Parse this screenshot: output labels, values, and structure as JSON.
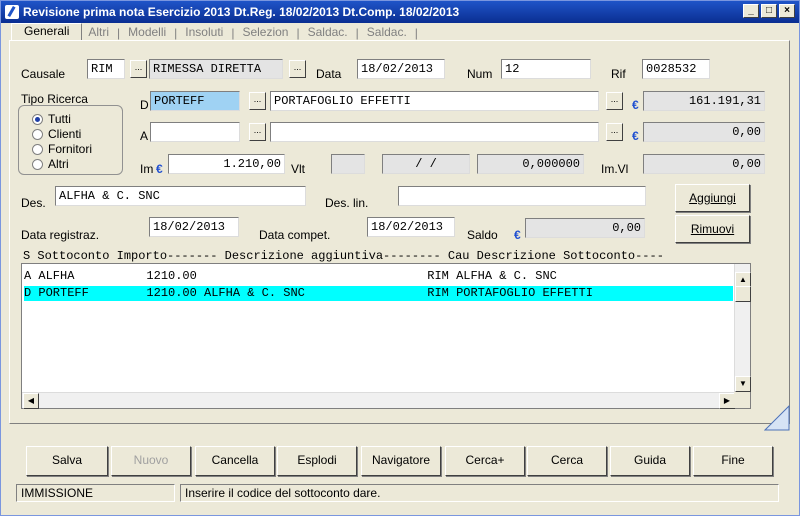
{
  "window": {
    "title": "Revisione prima nota  Esercizio 2013  Dt.Reg. 18/02/2013  Dt.Comp. 18/02/2013"
  },
  "tabs": [
    "Generali",
    "Altri",
    "Modelli",
    "Insoluti",
    "Selezion",
    "Saldac.",
    "Saldac."
  ],
  "form": {
    "causale_label": "Causale",
    "causale_code": "RIM",
    "causale_desc": "RIMESSA DIRETTA",
    "data_label": "Data",
    "data_value": "18/02/2013",
    "num_label": "Num",
    "num_value": "12",
    "rif_label": "Rif",
    "rif_value": "0028532",
    "tipo_ricerca_label": "Tipo Ricerca",
    "radio_options": [
      "Tutti",
      "Clienti",
      "Fornitori",
      "Altri"
    ],
    "radio_selected": "Tutti",
    "d_label": "D",
    "d_code": "PORTEFF",
    "d_desc": "PORTAFOGLIO EFFETTI",
    "d_amount": "161.191,31",
    "a_label": "A",
    "a_code": "",
    "a_desc": "",
    "a_amount": "0,00",
    "im_label": "Im",
    "im_value": "1.210,00",
    "vlt_label": "Vlt",
    "vlt_value": "",
    "vlt_date": "/  /",
    "vlt_rate": "0,000000",
    "imvl_label": "Im.Vl",
    "imvl_value": "0,00",
    "des_label": "Des.",
    "des_value": "ALFHA & C. SNC",
    "deslin_label": "Des. lin.",
    "deslin_value": "",
    "datareg_label": "Data registraz.",
    "datareg_value": "18/02/2013",
    "datacomp_label": "Data compet.",
    "datacomp_value": "18/02/2013",
    "saldo_label": "Saldo",
    "saldo_value": "0,00",
    "euro_symbol": "€"
  },
  "side_buttons": {
    "aggiungi": "Aggiungi",
    "rimuovi": "Rimuovi"
  },
  "list": {
    "header": "S Sottoconto Importo------- Descrizione aggiuntiva-------- Cau Descrizione Sottoconto----",
    "rows": [
      "A ALFHA          1210.00                                RIM ALFHA & C. SNC",
      "D PORTEFF        1210.00 ALFHA & C. SNC                 RIM PORTAFOGLIO EFFETTI"
    ],
    "selected_row": 1
  },
  "bottom_buttons": [
    "Salva",
    "Nuovo",
    "Cancella",
    "Esplodi",
    "Navigatore",
    "Cerca+",
    "Cerca",
    "Guida",
    "Fine"
  ],
  "status": {
    "mode": "IMMISSIONE",
    "message": "Inserire il codice del sottoconto dare."
  },
  "colors": {
    "titlebar": "#0a2e91",
    "selected_row": "#00ffff",
    "selected_field": "#9fd2f3",
    "euro": "#1f4fd1"
  }
}
